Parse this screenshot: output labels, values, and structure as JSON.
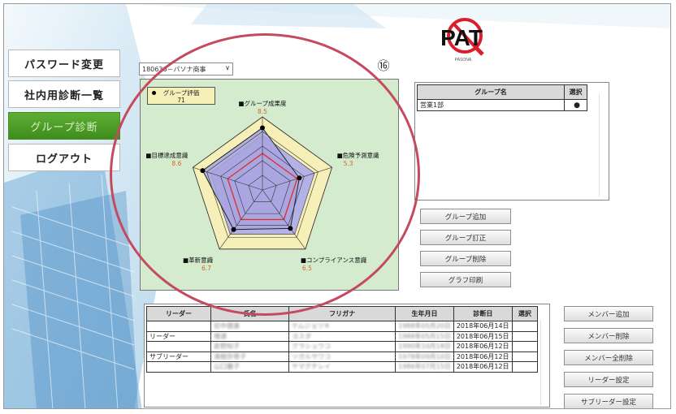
{
  "sidebar": {
    "items": [
      {
        "label": "パスワード変更"
      },
      {
        "label": "社内用診断一覧"
      },
      {
        "label": "グループ診断"
      },
      {
        "label": "ログアウト"
      }
    ]
  },
  "logo": {
    "text": "PAT",
    "subtext": "PASONA"
  },
  "step_badge": "⑯",
  "group_select": {
    "value": "180630－パソナ商事"
  },
  "chart": {
    "legend_label": "グループ評価",
    "legend_value": "71"
  },
  "chart_data": {
    "type": "radar",
    "axes": [
      "グループ成果度",
      "危険予測意識",
      "コンプライアンス意識",
      "革新意識",
      "目標達成意識"
    ],
    "values": [
      8.5,
      5.3,
      6.5,
      6.7,
      8.6
    ],
    "value_labels": [
      "8.5",
      "5.3",
      "6.5",
      "6.7",
      "8.6"
    ],
    "outer_max": 10,
    "band_value": 7.5,
    "red_value": 5,
    "rings": [
      2,
      4,
      6,
      8,
      10
    ],
    "colors": {
      "outer": "#f7efb8",
      "band": "#b3b1e6",
      "series": "#a7a4e0",
      "red": "#e0332f",
      "grid": "#333333",
      "value_label": "#d3642e"
    }
  },
  "group_table": {
    "headers": [
      "グループ名",
      "選択"
    ],
    "rows": [
      {
        "name": "営業1部",
        "mark": "●"
      }
    ]
  },
  "group_buttons": [
    "グループ追加",
    "グループ訂正",
    "グループ削除",
    "グラフ印刷"
  ],
  "member_table": {
    "headers": [
      "リーダー",
      "氏名",
      "フリガナ",
      "生年月日",
      "診断日",
      "選択"
    ],
    "rows": [
      {
        "role": "",
        "name": "岩中健康",
        "kana": "ケムジョツキ",
        "birth": "1988年05月20日",
        "date": "2018年06月14日",
        "select": ""
      },
      {
        "role": "リーダー",
        "name": "増選",
        "kana": "ヨスダ",
        "birth": "1988年05月15日",
        "date": "2018年06月15日",
        "select": ""
      },
      {
        "role": "",
        "name": "倉野知子",
        "kana": "クラシュウコ",
        "birth": "1990年10月18日",
        "date": "2018年06月12日",
        "select": ""
      },
      {
        "role": "サブリーダー",
        "name": "清樹奈帯子",
        "kana": "ソガルサワコ",
        "birth": "1978年09月10日",
        "date": "2018年06月12日",
        "select": ""
      },
      {
        "role": "",
        "name": "山口麗子",
        "kana": "ヤマグチレイ",
        "birth": "1986年07月15日",
        "date": "2018年06月12日",
        "select": ""
      }
    ]
  },
  "member_buttons": [
    "メンバー追加",
    "メンバー削除",
    "メンバー全削除",
    "リーダー設定",
    "サブリーダー設定"
  ]
}
